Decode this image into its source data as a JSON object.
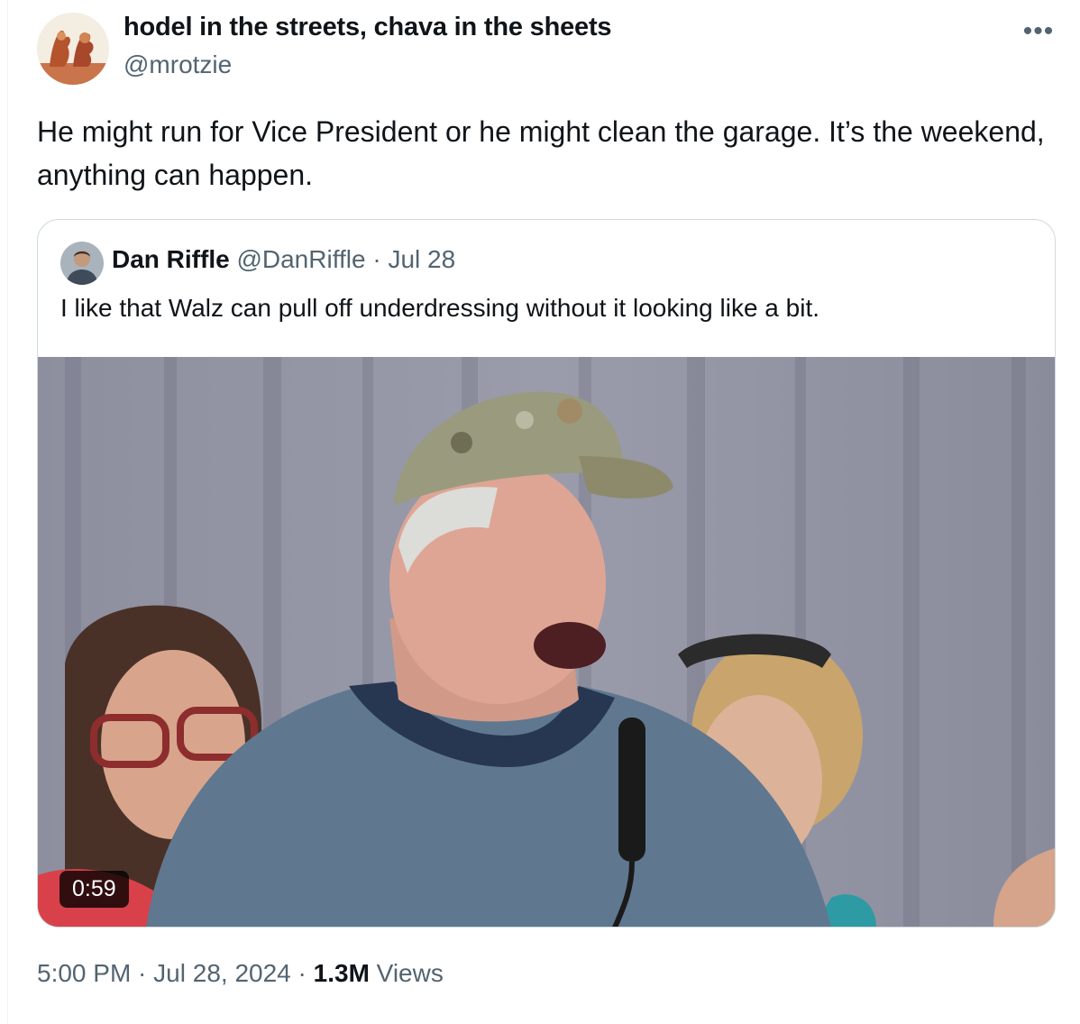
{
  "tweet": {
    "author": {
      "display_name": "hodel in the streets, chava in the sheets",
      "handle": "@mrotzie",
      "avatar_icon": "rock-formation-avatar"
    },
    "more_icon": "more-horizontal-icon",
    "more_glyph": "•••",
    "text": "He might run for Vice President or he might clean the garage. It’s the weekend, anything can happen.",
    "quoted": {
      "display_name": "Dan Riffle",
      "handle": "@DanRiffle",
      "separator": " · ",
      "date": "Jul 28",
      "text": "I like that Walz can pull off underdressing without it looking like a bit.",
      "media": {
        "type": "video",
        "duration": "0:59"
      }
    },
    "footer": {
      "time": "5:00 PM",
      "dot1": " · ",
      "date": "Jul 28, 2024",
      "dot2": " · ",
      "views_count": "1.3M",
      "views_label": " Views"
    }
  },
  "colors": {
    "text_primary": "#0f1419",
    "text_secondary": "#536471",
    "border": "#cfd9de"
  }
}
